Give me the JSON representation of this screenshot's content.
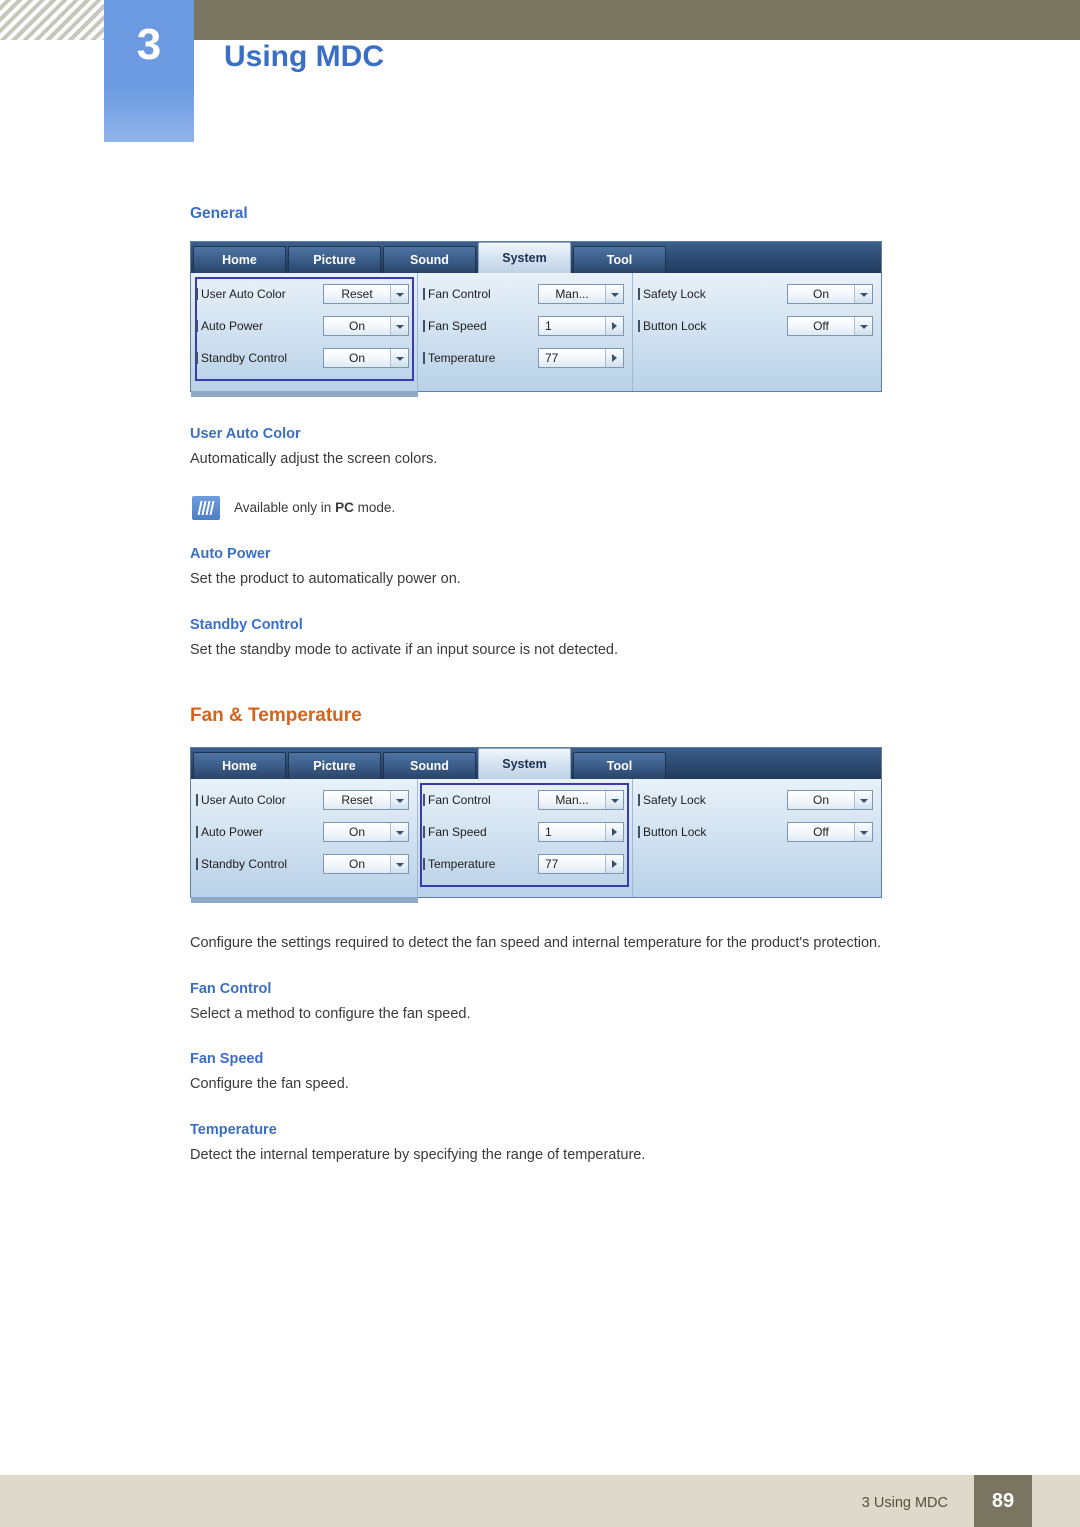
{
  "header": {
    "chapter_number": "3",
    "chapter_title": "Using MDC"
  },
  "sections": {
    "general": {
      "heading": "General",
      "terms": [
        {
          "title": "User Auto Color",
          "desc": "Automatically adjust the screen colors."
        },
        {
          "title": "Auto Power",
          "desc": "Set the product to automatically power on."
        },
        {
          "title": "Standby Control",
          "desc": "Set the standby mode to activate if an input source is not detected."
        }
      ],
      "note": {
        "icon": "note-icon",
        "prefix": "Available only in ",
        "bold": "PC",
        "suffix": " mode."
      }
    },
    "fan_temperature": {
      "heading": "Fan & Temperature",
      "intro": "Configure the settings required to detect the fan speed and internal temperature for the product's protection.",
      "terms": [
        {
          "title": "Fan Control",
          "desc": "Select a method to configure the fan speed."
        },
        {
          "title": "Fan Speed",
          "desc": "Configure the fan speed."
        },
        {
          "title": "Temperature",
          "desc": "Detect the internal temperature by specifying the range of temperature."
        }
      ]
    }
  },
  "mdc": {
    "tabs": [
      {
        "label": "Home",
        "active": false
      },
      {
        "label": "Picture",
        "active": false
      },
      {
        "label": "Sound",
        "active": false
      },
      {
        "label": "System",
        "active": true
      },
      {
        "label": "Tool",
        "active": false
      }
    ],
    "group_general": [
      {
        "label": "User Auto Color",
        "value": "Reset",
        "control": "dropdown"
      },
      {
        "label": "Auto Power",
        "value": "On",
        "control": "dropdown"
      },
      {
        "label": "Standby Control",
        "value": "On",
        "control": "dropdown"
      }
    ],
    "group_fan": [
      {
        "label": "Fan Control",
        "value": "Man...",
        "control": "dropdown"
      },
      {
        "label": "Fan Speed",
        "value": "1",
        "control": "spinner"
      },
      {
        "label": "Temperature",
        "value": "77",
        "control": "spinner"
      }
    ],
    "group_lock": [
      {
        "label": "Safety Lock",
        "value": "On",
        "control": "dropdown"
      },
      {
        "label": "Button Lock",
        "value": "Off",
        "control": "dropdown"
      }
    ]
  },
  "footer": {
    "label": "3 Using MDC",
    "page": "89"
  },
  "colors": {
    "accent_blue": "#3a6fc4",
    "accent_orange": "#d2641e",
    "header_tan": "#7a7560",
    "footer_tan": "#ded9cb",
    "highlight_border": "#3b3bb0"
  }
}
